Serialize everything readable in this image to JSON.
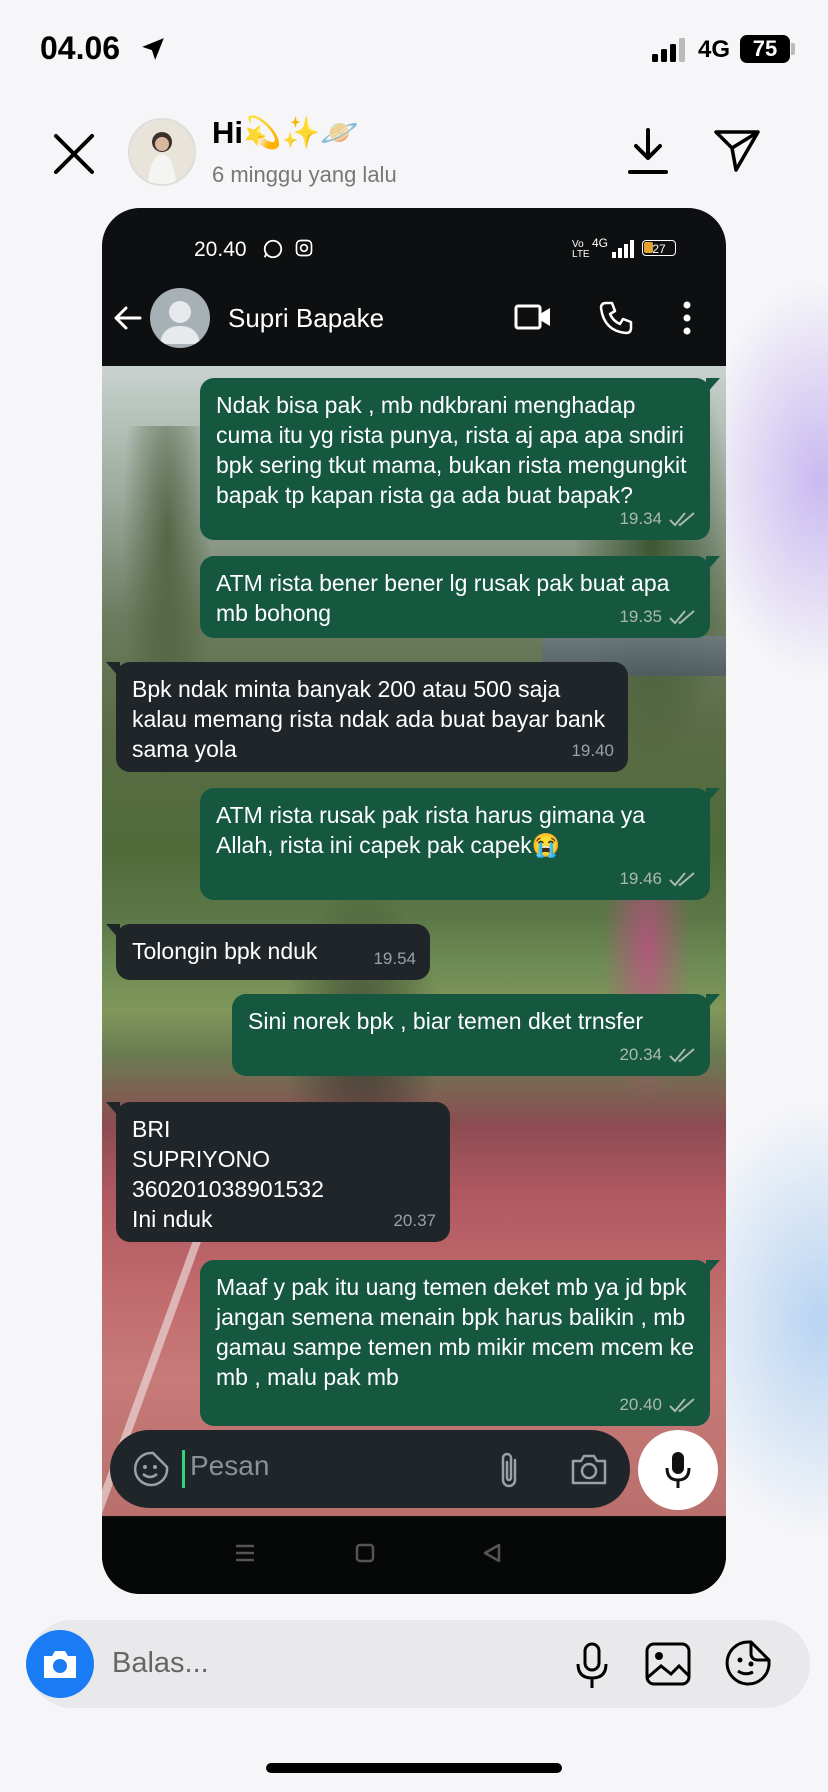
{
  "ios_status": {
    "time": "04.06",
    "network": "4G",
    "battery": "75"
  },
  "story": {
    "title": "Hi💫✨🪐",
    "time_ago": "6 minggu yang lalu"
  },
  "phone_status": {
    "time": "20.40",
    "volte": "Vo LTE",
    "signal": "4G",
    "battery": "27"
  },
  "chat": {
    "contact_name": "Supri Bapake",
    "messages": [
      {
        "dir": "out",
        "text": "Ndak bisa pak , mb ndkbrani menghadap cuma itu yg rista punya, rista aj apa apa sndiri bpk sering tkut mama, bukan rista mengungkit bapak tp kapan rista ga ada buat bapak?",
        "time": "19.34"
      },
      {
        "dir": "out",
        "text": "ATM rista bener bener lg rusak pak buat apa mb bohong",
        "time": "19.35"
      },
      {
        "dir": "in",
        "text": "Bpk ndak minta banyak 200 atau 500 saja kalau memang rista ndak ada buat bayar bank sama yola",
        "time": "19.40"
      },
      {
        "dir": "out",
        "text": "ATM rista rusak pak rista harus gimana ya Allah, rista ini capek pak capek😭",
        "time": "19.46"
      },
      {
        "dir": "in",
        "text": "Tolongin bpk nduk",
        "time": "19.54"
      },
      {
        "dir": "out",
        "text": "Sini norek bpk , biar temen dket trnsfer",
        "time": "20.34"
      },
      {
        "dir": "in",
        "text": "BRI\nSUPRIYONO\n360201038901532\nIni nduk",
        "time": "20.37"
      },
      {
        "dir": "out",
        "text": "Maaf y pak itu uang temen deket mb ya jd bpk jangan semena menain bpk harus balikin , mb gamau sampe temen mb mikir mcem mcem ke mb , malu pak mb",
        "time": "20.40"
      }
    ],
    "input_placeholder": "Pesan"
  },
  "reply": {
    "placeholder": "Balas..."
  },
  "colors": {
    "outgoing_bubble": "#15583f",
    "incoming_bubble": "#202529",
    "reply_camera": "#1a7cf5"
  }
}
